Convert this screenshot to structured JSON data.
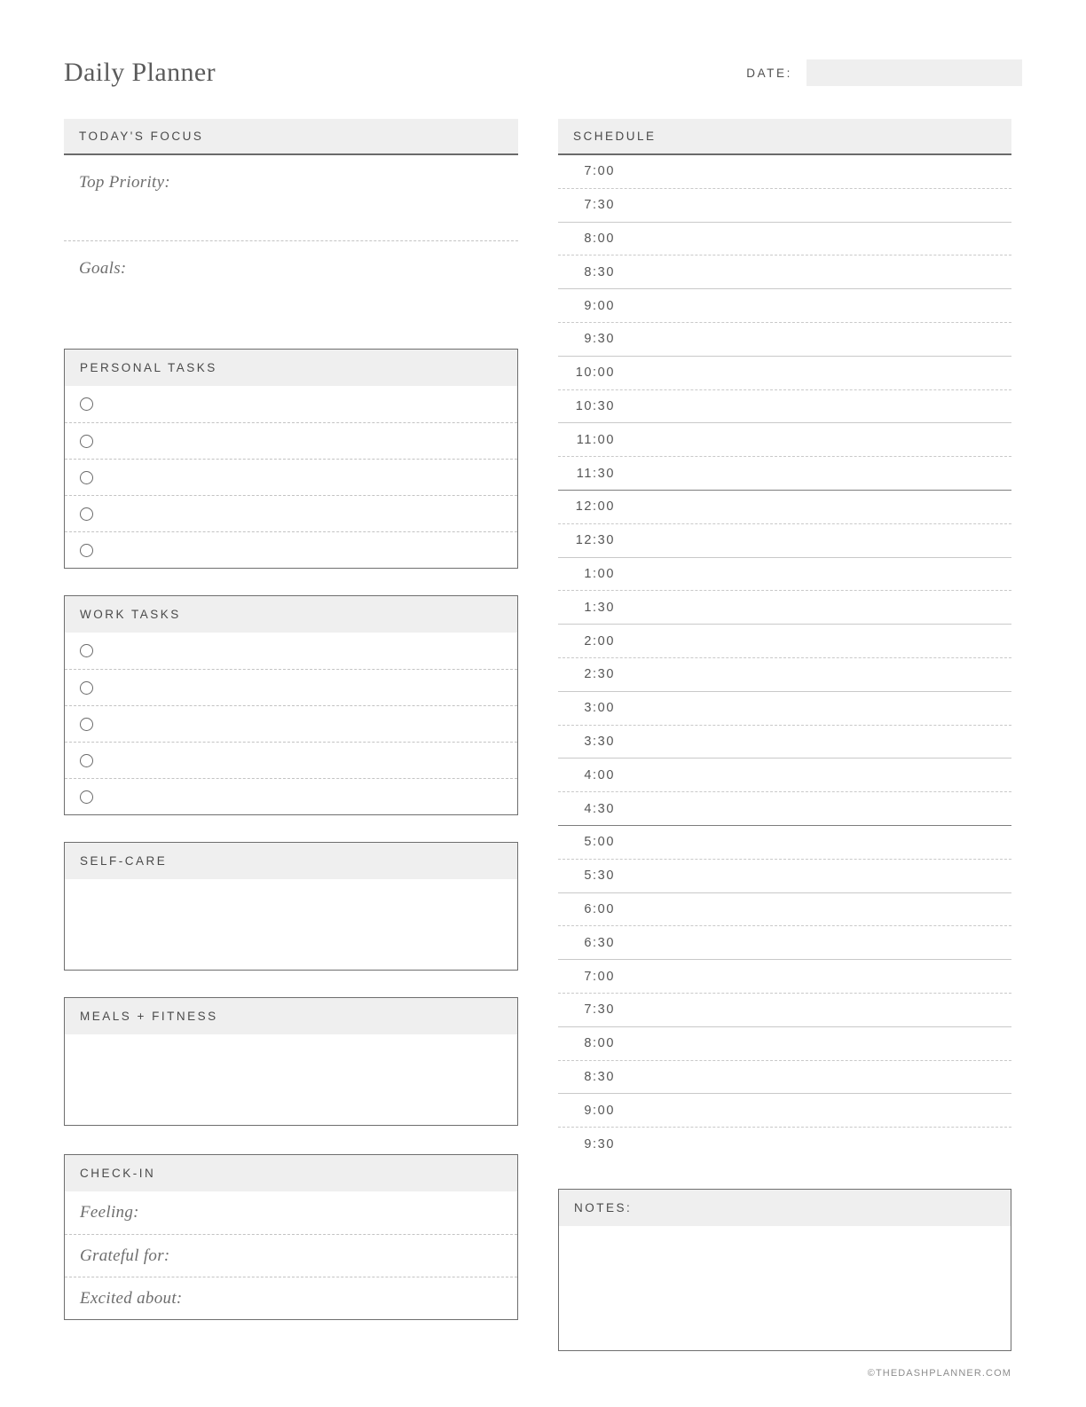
{
  "header": {
    "title": "Daily Planner",
    "date_label": "DATE:",
    "date_value": ""
  },
  "focus": {
    "heading": "TODAY'S FOCUS",
    "rows": [
      {
        "label": "Top Priority:",
        "value": ""
      },
      {
        "label": "Goals:",
        "value": ""
      }
    ]
  },
  "personal_tasks": {
    "heading": "PERSONAL TASKS",
    "items": [
      "",
      "",
      "",
      "",
      ""
    ]
  },
  "work_tasks": {
    "heading": "WORK TASKS",
    "items": [
      "",
      "",
      "",
      "",
      ""
    ]
  },
  "self_care": {
    "heading": "SELF-CARE",
    "value": ""
  },
  "meals_fitness": {
    "heading": "MEALS + FITNESS",
    "value": ""
  },
  "check_in": {
    "heading": "CHECK-IN",
    "rows": [
      {
        "label": "Feeling:",
        "value": ""
      },
      {
        "label": "Grateful for:",
        "value": ""
      },
      {
        "label": "Excited about:",
        "value": ""
      }
    ]
  },
  "schedule": {
    "heading": "SCHEDULE",
    "rows": [
      {
        "time": "7:00",
        "value": "",
        "sep": "dashed"
      },
      {
        "time": "7:30",
        "value": "",
        "sep": "solid"
      },
      {
        "time": "8:00",
        "value": "",
        "sep": "dashed"
      },
      {
        "time": "8:30",
        "value": "",
        "sep": "solid"
      },
      {
        "time": "9:00",
        "value": "",
        "sep": "dashed"
      },
      {
        "time": "9:30",
        "value": "",
        "sep": "solid"
      },
      {
        "time": "10:00",
        "value": "",
        "sep": "dashed"
      },
      {
        "time": "10:30",
        "value": "",
        "sep": "solid"
      },
      {
        "time": "11:00",
        "value": "",
        "sep": "dashed"
      },
      {
        "time": "11:30",
        "value": "",
        "sep": "bold"
      },
      {
        "time": "12:00",
        "value": "",
        "sep": "dashed"
      },
      {
        "time": "12:30",
        "value": "",
        "sep": "solid"
      },
      {
        "time": "1:00",
        "value": "",
        "sep": "dashed"
      },
      {
        "time": "1:30",
        "value": "",
        "sep": "solid"
      },
      {
        "time": "2:00",
        "value": "",
        "sep": "dashed"
      },
      {
        "time": "2:30",
        "value": "",
        "sep": "solid"
      },
      {
        "time": "3:00",
        "value": "",
        "sep": "dashed"
      },
      {
        "time": "3:30",
        "value": "",
        "sep": "solid"
      },
      {
        "time": "4:00",
        "value": "",
        "sep": "dashed"
      },
      {
        "time": "4:30",
        "value": "",
        "sep": "bold"
      },
      {
        "time": "5:00",
        "value": "",
        "sep": "dashed"
      },
      {
        "time": "5:30",
        "value": "",
        "sep": "solid"
      },
      {
        "time": "6:00",
        "value": "",
        "sep": "dashed"
      },
      {
        "time": "6:30",
        "value": "",
        "sep": "solid"
      },
      {
        "time": "7:00",
        "value": "",
        "sep": "dashed"
      },
      {
        "time": "7:30",
        "value": "",
        "sep": "solid"
      },
      {
        "time": "8:00",
        "value": "",
        "sep": "dashed"
      },
      {
        "time": "8:30",
        "value": "",
        "sep": "solid"
      },
      {
        "time": "9:00",
        "value": "",
        "sep": "dashed"
      },
      {
        "time": "9:30",
        "value": "",
        "sep": "none"
      }
    ]
  },
  "notes": {
    "heading": "NOTES:",
    "value": ""
  },
  "footer": {
    "copyright": "©THEDASHPLANNER.COM"
  },
  "colors": {
    "header_fill": "#efefef",
    "rule_dark": "#6a6a6a",
    "rule_light": "#c9c9c9",
    "text": "#4a4a4a",
    "text_muted": "#6e6e6e"
  }
}
